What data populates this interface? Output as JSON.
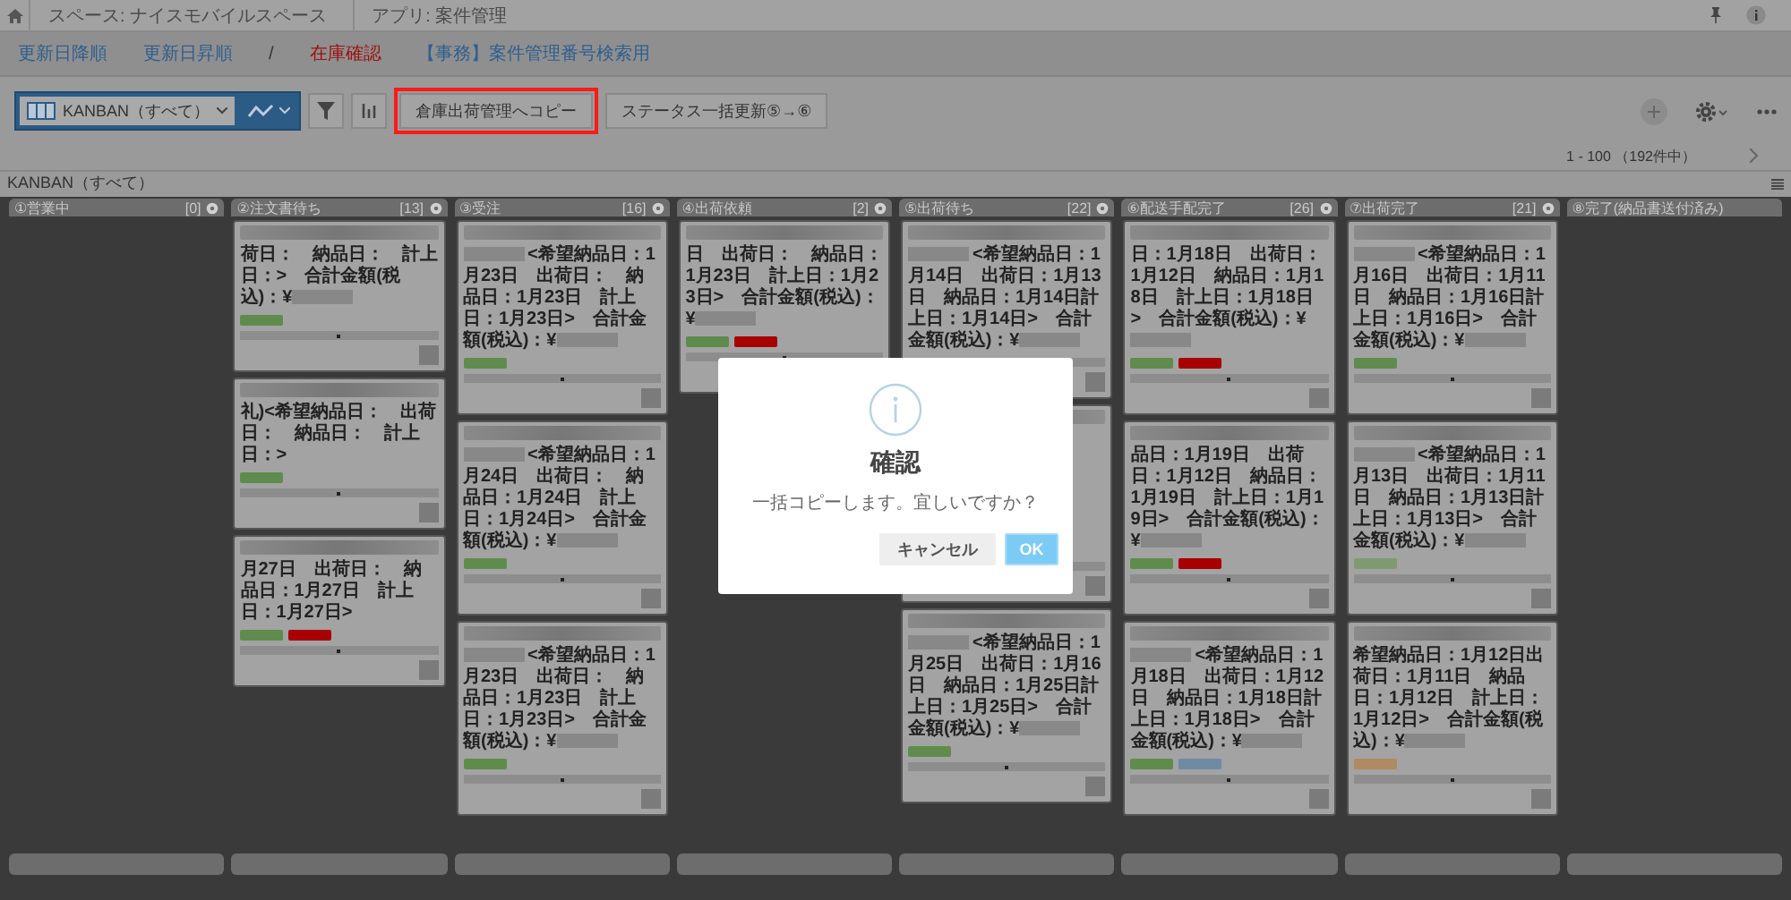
{
  "breadcrumb": {
    "items": [
      "スペース: ナイスモバイルスペース",
      "アプリ: 案件管理"
    ]
  },
  "nav": [
    {
      "label": "更新日降順",
      "color": "#2f5f8f"
    },
    {
      "label": "更新日昇順",
      "color": "#2f5f8f"
    },
    {
      "label": "/",
      "color": "#333333"
    },
    {
      "label": "在庫確認",
      "color": "#a01010"
    },
    {
      "label": "【事務】案件管理番号検索用",
      "color": "#2f5f8f"
    }
  ],
  "toolbar": {
    "view_select": "KANBAN（すべて）",
    "buttons": [
      {
        "label": "倉庫出荷管理へコピー",
        "highlighted": true
      },
      {
        "label": "ステータス一括更新⑤→⑥",
        "highlighted": false
      }
    ]
  },
  "pager": {
    "range": "1 - 100 （192件中）"
  },
  "board": {
    "title": "KANBAN（すべて）",
    "columns": [
      {
        "title": "①営業中",
        "count": "[0]"
      },
      {
        "title": "②注文書待ち",
        "count": "[13]",
        "cards": [
          {
            "lead_blur": false,
            "text": "荷日：　納品日：　計上日：>　合計金額(税込)：¥",
            "amount_blur": true,
            "tags": [
              {
                "color": "#5f8c4c"
              }
            ]
          },
          {
            "lead_blur": false,
            "text": "礼)<希望納品日：　出荷日：　納品日：　計上日：>",
            "amount_blur": false,
            "tags": [
              {
                "color": "#5f8c4c"
              }
            ]
          },
          {
            "lead_blur": false,
            "text": "月27日　出荷日：　納品日：1月27日　計上日：1月27日>",
            "amount_blur": false,
            "tags": [
              {
                "color": "#5f8c4c"
              },
              {
                "color": "#a80000"
              }
            ]
          }
        ]
      },
      {
        "title": "③受注",
        "count": "[16]",
        "cards": [
          {
            "lead_blur": true,
            "text": "<希望納品日：1月23日　出荷日：　納品日：1月23日　計上日：1月23日>　合計金額(税込)：¥",
            "amount_blur": true,
            "tags": [
              {
                "color": "#5f8c4c"
              }
            ]
          },
          {
            "lead_blur": true,
            "text": "<希望納品日：1月24日　出荷日：　納品日：1月24日　計上日：1月24日>　合計金額(税込)：¥",
            "amount_blur": true,
            "tags": [
              {
                "color": "#5f8c4c"
              }
            ]
          },
          {
            "lead_blur": true,
            "text": "<希望納品日：1月23日　出荷日：　納品日：1月23日　計上日：1月23日>　合計金額(税込)：¥",
            "amount_blur": true,
            "tags": [
              {
                "color": "#5f8c4c"
              }
            ]
          }
        ]
      },
      {
        "title": "④出荷依頼",
        "count": "[2]",
        "cards": [
          {
            "lead_blur": false,
            "text": "日　出荷日：　納品日：1月23日　計上日：1月23日>　合計金額(税込)：¥",
            "amount_blur": true,
            "tags": [
              {
                "color": "#5f8c4c"
              },
              {
                "color": "#a80000"
              }
            ]
          }
        ]
      },
      {
        "title": "⑤出荷待ち",
        "count": "[22]",
        "cards": [
          {
            "lead_blur": true,
            "text": "<希望納品日：1月14日　出荷日：1月13日　納品日：1月14日計上日：1月14日>　合計金額(税込)：¥",
            "amount_blur": true
          },
          {
            "covered": true
          },
          {
            "lead_blur": true,
            "text": "<希望納品日：1月25日　出荷日：1月16日　納品日：1月25日計上日：1月25日>　合計金額(税込)：¥",
            "amount_blur": true,
            "tags": [
              {
                "color": "#5f8c4c"
              }
            ]
          }
        ]
      },
      {
        "title": "⑥配送手配完了",
        "count": "[26]",
        "cards": [
          {
            "lead_blur": false,
            "text": "日：1月18日　出荷日：1月12日　納品日：1月18日　計上日：1月18日>　合計金額(税込)：¥",
            "amount_blur": true,
            "tags": [
              {
                "color": "#5f8c4c"
              },
              {
                "color": "#a80000"
              }
            ]
          },
          {
            "lead_blur": false,
            "text": "品日：1月19日　出荷日：1月12日　納品日：1月19日　計上日：1月19日>　合計金額(税込)：¥",
            "amount_blur": true,
            "tags": [
              {
                "color": "#5f8c4c"
              },
              {
                "color": "#a80000"
              }
            ]
          },
          {
            "lead_blur": true,
            "text": "<希望納品日：1月18日　出荷日：1月12日　納品日：1月18日計上日：1月18日>　合計金額(税込)：¥",
            "amount_blur": true,
            "tags": [
              {
                "color": "#5f8c4c"
              },
              {
                "color": "#6f8aa3"
              }
            ]
          }
        ]
      },
      {
        "title": "⑦出荷完了",
        "count": "[21]",
        "cards": [
          {
            "lead_blur": true,
            "text": "<希望納品日：1月16日　出荷日：1月11日　納品日：1月16日計上日：1月16日>　合計金額(税込)：¥",
            "amount_blur": true,
            "tags": [
              {
                "color": "#5f8c4c"
              }
            ]
          },
          {
            "lead_blur": true,
            "text": "<希望納品日：1月13日　出荷日：1月11日　納品日：1月13日計上日：1月13日>　合計金額(税込)：¥",
            "amount_blur": true,
            "tags": [
              {
                "color": "#7f9a70"
              }
            ]
          },
          {
            "lead_blur": false,
            "text": "希望納品日：1月12日出荷日：1月11日　納品日：1月12日　計上日：1月12日>　合計金額(税込)：¥",
            "amount_blur": true,
            "tags": [
              {
                "color": "#b08a60"
              }
            ]
          }
        ]
      },
      {
        "title": "⑧完了(納品書送付済み)"
      }
    ]
  },
  "dialog": {
    "title": "確認",
    "message": "一括コピーします。宜しいですか？",
    "buttons": [
      {
        "label": "キャンセル",
        "kind": "secondary"
      },
      {
        "label": "OK",
        "kind": "primary"
      }
    ]
  }
}
